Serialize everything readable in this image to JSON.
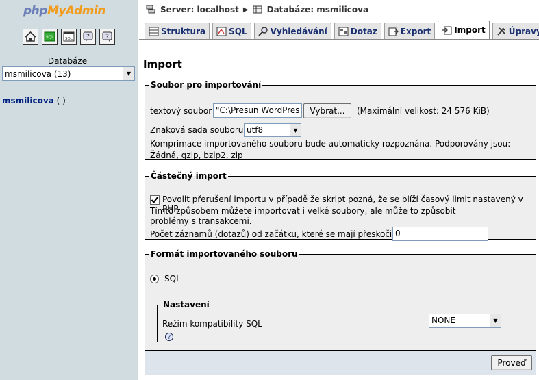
{
  "sidebar": {
    "logo": {
      "part1": "php",
      "part2": "MyAdmin"
    },
    "db_label": "Databáze",
    "db_select_value": "msmilicova (13)",
    "db_link_name": "msmilicova",
    "db_link_suffix": "(  )",
    "nav_icons": [
      "home-icon",
      "sql-query-icon",
      "sql-window-icon",
      "help-icon",
      "docs-icon"
    ]
  },
  "breadcrumb": {
    "server": "Server: localhost",
    "database": "Databáze: msmilicova"
  },
  "tabs": [
    {
      "label": "Struktura",
      "icon": "structure-icon"
    },
    {
      "label": "SQL",
      "icon": "sql-icon"
    },
    {
      "label": "Vyhledávání",
      "icon": "search-icon"
    },
    {
      "label": "Dotaz",
      "icon": "query-icon"
    },
    {
      "label": "Export",
      "icon": "export-icon"
    },
    {
      "label": "Import",
      "icon": "import-icon",
      "active": true
    },
    {
      "label": "Úpravy",
      "icon": "operations-icon"
    }
  ],
  "page_title": "Import",
  "file_section": {
    "legend": "Soubor pro importování",
    "file_label": "textový soubor",
    "file_value": "\"C:\\Presun WordPres",
    "browse_label": "Vybrat...",
    "max_size": "(Maximální velikost: 24 576 KiB)",
    "charset_label": "Znaková sada souboru:",
    "charset_value": "utf8",
    "compression_note": "Komprimace importovaného souboru bude automaticky rozpoznána. Podporovány jsou: Žádná, gzip, bzip2, zip"
  },
  "partial_section": {
    "legend": "Částečný import",
    "allow_interrupt_label": "Povolit přerušení importu v případě že skript pozná, že se blíží časový limit nastavený v PHP.",
    "allow_interrupt_checked": true,
    "note": "Tímto způsobem můžete importovat i velké soubory, ale může to způsobit problémy s transakcemi.",
    "skip_label": "Počet záznamů (dotazů) od začátku, které se mají přeskočit",
    "skip_value": "0"
  },
  "format_section": {
    "legend": "Formát importovaného souboru",
    "format_option": "SQL",
    "format_selected": true,
    "settings_legend": "Nastavení",
    "compat_label": "Režim kompatibility SQL",
    "compat_value": "NONE"
  },
  "submit_label": "Proveď"
}
